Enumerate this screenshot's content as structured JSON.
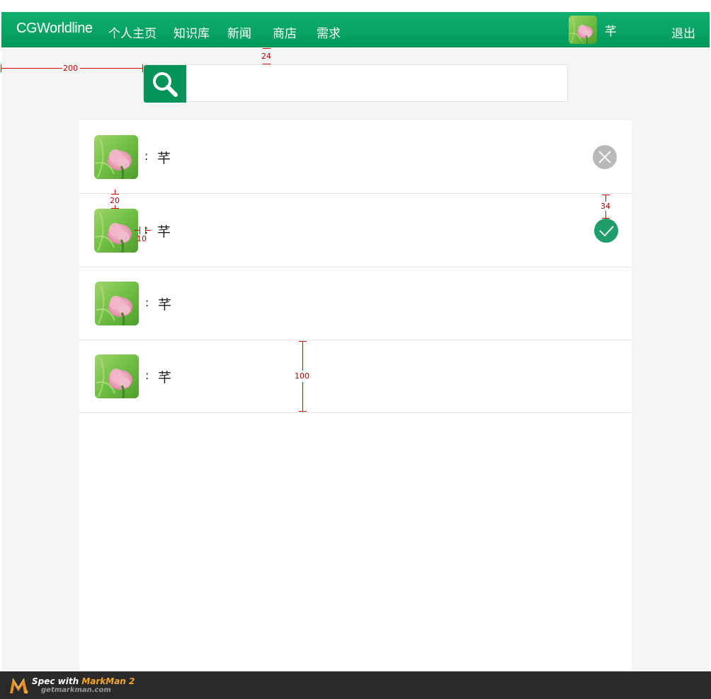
{
  "header": {
    "brand": "CGWorldline",
    "nav": [
      {
        "label": "个人主页"
      },
      {
        "label": "知识库"
      },
      {
        "label": "新闻"
      },
      {
        "label": "商店"
      },
      {
        "label": "需求"
      }
    ],
    "username": "芊",
    "logout_label": "退出"
  },
  "search": {
    "icon": "search-icon",
    "value": "",
    "placeholder": ""
  },
  "list": {
    "rows": [
      {
        "colon": ":",
        "name": "芊",
        "action": "reject",
        "action_icon": "close-icon"
      },
      {
        "colon": ":",
        "name": "芊",
        "action": "accept",
        "action_icon": "check-icon"
      },
      {
        "colon": ":",
        "name": "芊",
        "action": "none"
      },
      {
        "colon": ":",
        "name": "芊",
        "action": "none"
      }
    ]
  },
  "spec_annotations": {
    "left_margin": "200",
    "search_top_gap": "24",
    "avatar_top_gap": "20",
    "avatar_name_gap": "10",
    "action_top_gap": "34",
    "row_height": "100"
  },
  "footer": {
    "title_prefix": "Spec with ",
    "title_brand": "MarkMan 2",
    "url": "getmarkman.com"
  },
  "colors": {
    "brand_green": "#049457",
    "header_green": "#0eb06e",
    "reject_gray": "#b9b9b9",
    "accept_green": "#1f9e6b",
    "spec_red": "#d40000",
    "accent_orange": "#f5a623"
  }
}
